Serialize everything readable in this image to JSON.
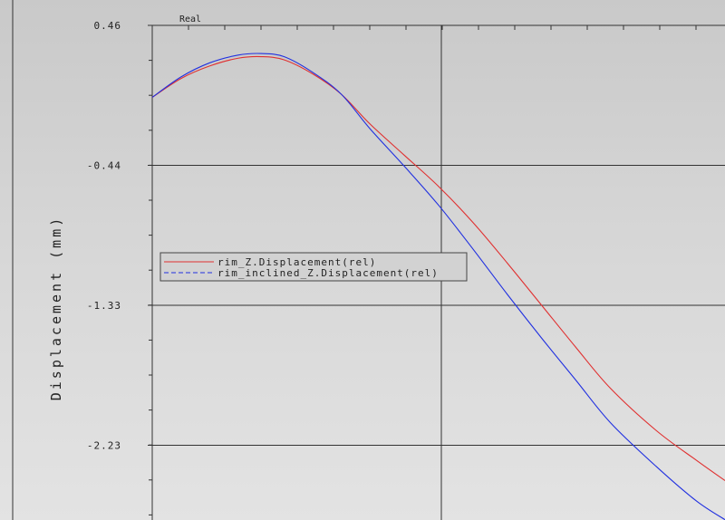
{
  "chart_data": {
    "type": "line",
    "title": "Real",
    "xlabel": "",
    "ylabel": "Displacement (mm)",
    "yticks": [
      "0.46",
      "-0.44",
      "-1.33",
      "-2.23"
    ],
    "ylim": [
      -2.668,
      0.46
    ],
    "grid": true,
    "legend_position": "center-left",
    "series": [
      {
        "name": "rim_Z.Displacement(rel)",
        "color": "#e03030",
        "style": "solid",
        "x": [
          0,
          0.05,
          0.1,
          0.15,
          0.19,
          0.23,
          0.28,
          0.33,
          0.38,
          0.44,
          0.5,
          0.56,
          0.62,
          0.68,
          0.74,
          0.8,
          0.88,
          0.95,
          1.0
        ],
        "y": [
          -0.0,
          0.12,
          0.2,
          0.25,
          0.26,
          0.24,
          0.15,
          0.02,
          -0.17,
          -0.37,
          -0.57,
          -0.8,
          -1.06,
          -1.33,
          -1.6,
          -1.86,
          -2.13,
          -2.32,
          -2.45
        ]
      },
      {
        "name": "rim_inclined_Z.Displacement(rel)",
        "color": "#2030e0",
        "style": "dashed",
        "x": [
          0,
          0.05,
          0.1,
          0.15,
          0.19,
          0.23,
          0.28,
          0.33,
          0.38,
          0.44,
          0.5,
          0.56,
          0.62,
          0.68,
          0.74,
          0.8,
          0.88,
          0.95,
          1.0
        ],
        "y": [
          -0.0,
          0.13,
          0.22,
          0.27,
          0.28,
          0.26,
          0.16,
          0.02,
          -0.2,
          -0.44,
          -0.69,
          -0.97,
          -1.26,
          -1.54,
          -1.81,
          -2.08,
          -2.36,
          -2.58,
          -2.7
        ]
      }
    ]
  }
}
